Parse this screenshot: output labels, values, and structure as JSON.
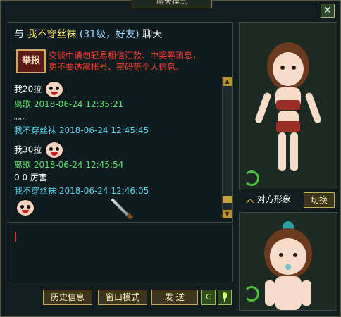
{
  "window": {
    "title": "聊天模式",
    "close_label": "✕"
  },
  "chat": {
    "header": {
      "prefix": "与",
      "friend_name": "我不穿丝袜",
      "friend_info": "(31级，好友)",
      "suffix": "聊天"
    },
    "warning": {
      "report_label": "举报",
      "lines": [
        "交谈中请勿轻易相信汇款、中奖等消息，",
        "更不要透露帐号、密码等个人信息。"
      ]
    },
    "messages": [
      {
        "text": "我20拉"
      },
      {
        "meta": "离歌  2018-06-24 12:35:21"
      },
      {
        "text": "。。。"
      },
      {
        "meta": "我不穿丝袜  2018-06-24 12:45:45"
      },
      {
        "text": "我30拉"
      },
      {
        "meta": "离歌  2018-06-24 12:45:54"
      },
      {
        "text": "0 0 厉害"
      },
      {
        "meta": "我不穿丝袜  2018-06-24 12:46:05"
      }
    ],
    "scroll": {
      "up_icon": "▲",
      "down_icon": "▼"
    }
  },
  "buttons": {
    "history": "历史信息",
    "window_mode": "窗口模式",
    "send": "发 送",
    "c_label": "C",
    "voice_icon": "mic-icon"
  },
  "portraits": {
    "caption": "对方形象",
    "switch": "切换",
    "refresh_icon": "refresh-icon"
  }
}
